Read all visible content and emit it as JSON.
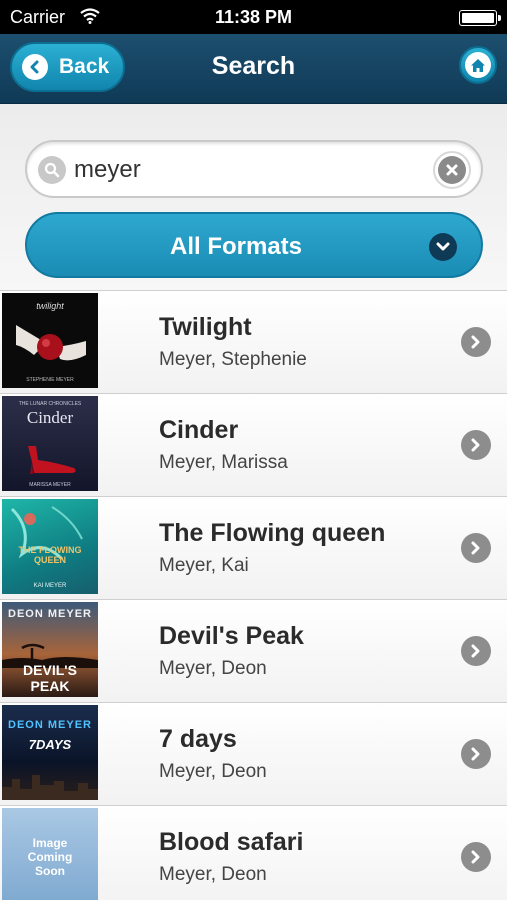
{
  "status_bar": {
    "carrier": "Carrier",
    "time": "11:38 PM"
  },
  "nav": {
    "back_label": "Back",
    "title": "Search",
    "home_icon": "home-icon"
  },
  "search": {
    "value": "meyer",
    "format_label": "All Formats"
  },
  "colors": {
    "nav_bg": "#0f3a56",
    "accent": "#1a8cb4"
  },
  "results": [
    {
      "title": "Twilight",
      "author": "Meyer, Stephenie",
      "cover": {
        "title_text": "twilight",
        "author_text": "STEPHENIE MEYER"
      }
    },
    {
      "title": "Cinder",
      "author": "Meyer, Marissa",
      "cover": {
        "top_text": "THE LUNAR CHRONICLES",
        "title_text": "Cinder",
        "author_text": "MARISSA MEYER"
      }
    },
    {
      "title": "The Flowing queen",
      "author": "Meyer, Kai",
      "cover": {
        "title_text": "THE FLOWING QUEEN",
        "author_text": "KAI MEYER"
      }
    },
    {
      "title": "Devil's Peak",
      "author": "Meyer, Deon",
      "cover": {
        "top_text": "DEON MEYER",
        "title_text": "DEVIL'S PEAK"
      }
    },
    {
      "title": "7 days",
      "author": "Meyer, Deon",
      "cover": {
        "top_text": "DEON MEYER",
        "title_text": "7DAYS"
      }
    },
    {
      "title": "Blood safari",
      "author": "Meyer, Deon",
      "cover": {
        "title_text": "Image Coming Soon"
      }
    }
  ]
}
